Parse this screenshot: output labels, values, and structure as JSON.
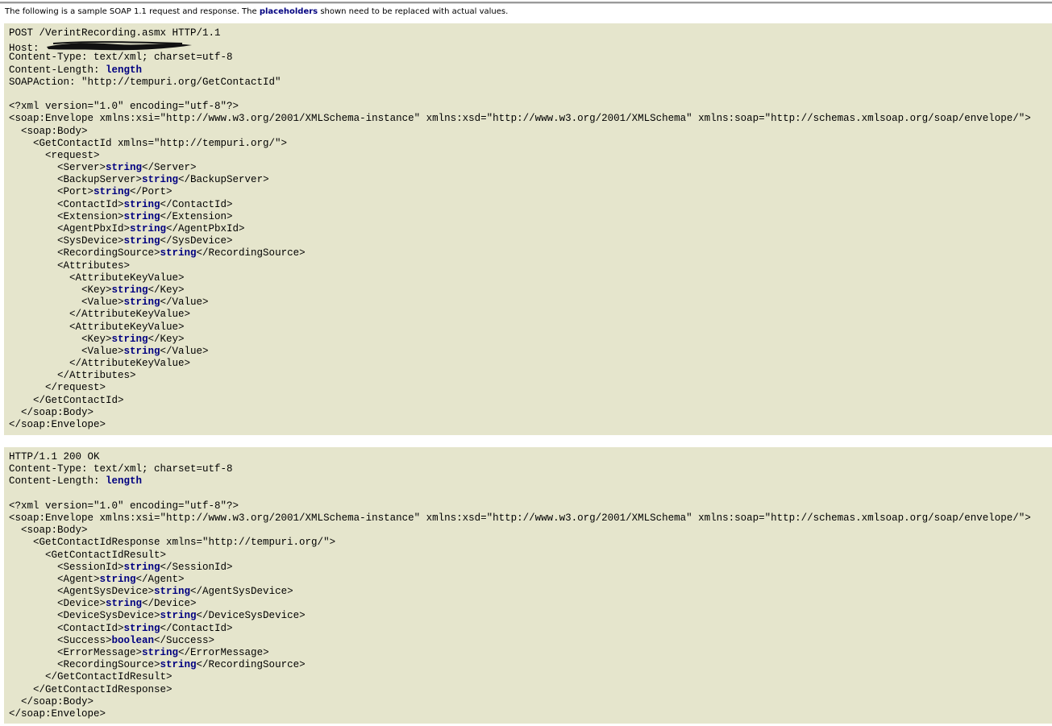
{
  "intro": {
    "pre": "The following is a sample SOAP 1.1 request and response. The ",
    "highlight": "placeholders",
    "post": " shown need to be replaced with actual values."
  },
  "colors": {
    "block_bg": "#e5e5cc",
    "placeholder": "#000080"
  },
  "request": [
    {
      "pre": "POST /VerintRecording.asmx HTTP/1.1"
    },
    {
      "pre": "Host: ",
      "redacted": true
    },
    {
      "pre": "Content-Type: text/xml; charset=utf-8"
    },
    {
      "pre": "Content-Length: ",
      "ph": "length"
    },
    {
      "pre": "SOAPAction: \"http://tempuri.org/GetContactId\""
    },
    {
      "pre": ""
    },
    {
      "pre": "<?xml version=\"1.0\" encoding=\"utf-8\"?>"
    },
    {
      "pre": "<soap:Envelope xmlns:xsi=\"http://www.w3.org/2001/XMLSchema-instance\" xmlns:xsd=\"http://www.w3.org/2001/XMLSchema\" xmlns:soap=\"http://schemas.xmlsoap.org/soap/envelope/\">"
    },
    {
      "pre": "  <soap:Body>"
    },
    {
      "pre": "    <GetContactId xmlns=\"http://tempuri.org/\">"
    },
    {
      "pre": "      <request>"
    },
    {
      "pre": "        <Server>",
      "ph": "string",
      "post": "</Server>"
    },
    {
      "pre": "        <BackupServer>",
      "ph": "string",
      "post": "</BackupServer>"
    },
    {
      "pre": "        <Port>",
      "ph": "string",
      "post": "</Port>"
    },
    {
      "pre": "        <ContactId>",
      "ph": "string",
      "post": "</ContactId>"
    },
    {
      "pre": "        <Extension>",
      "ph": "string",
      "post": "</Extension>"
    },
    {
      "pre": "        <AgentPbxId>",
      "ph": "string",
      "post": "</AgentPbxId>"
    },
    {
      "pre": "        <SysDevice>",
      "ph": "string",
      "post": "</SysDevice>"
    },
    {
      "pre": "        <RecordingSource>",
      "ph": "string",
      "post": "</RecordingSource>"
    },
    {
      "pre": "        <Attributes>"
    },
    {
      "pre": "          <AttributeKeyValue>"
    },
    {
      "pre": "            <Key>",
      "ph": "string",
      "post": "</Key>"
    },
    {
      "pre": "            <Value>",
      "ph": "string",
      "post": "</Value>"
    },
    {
      "pre": "          </AttributeKeyValue>"
    },
    {
      "pre": "          <AttributeKeyValue>"
    },
    {
      "pre": "            <Key>",
      "ph": "string",
      "post": "</Key>"
    },
    {
      "pre": "            <Value>",
      "ph": "string",
      "post": "</Value>"
    },
    {
      "pre": "          </AttributeKeyValue>"
    },
    {
      "pre": "        </Attributes>"
    },
    {
      "pre": "      </request>"
    },
    {
      "pre": "    </GetContactId>"
    },
    {
      "pre": "  </soap:Body>"
    },
    {
      "pre": "</soap:Envelope>"
    }
  ],
  "response": [
    {
      "pre": "HTTP/1.1 200 OK"
    },
    {
      "pre": "Content-Type: text/xml; charset=utf-8"
    },
    {
      "pre": "Content-Length: ",
      "ph": "length"
    },
    {
      "pre": ""
    },
    {
      "pre": "<?xml version=\"1.0\" encoding=\"utf-8\"?>"
    },
    {
      "pre": "<soap:Envelope xmlns:xsi=\"http://www.w3.org/2001/XMLSchema-instance\" xmlns:xsd=\"http://www.w3.org/2001/XMLSchema\" xmlns:soap=\"http://schemas.xmlsoap.org/soap/envelope/\">"
    },
    {
      "pre": "  <soap:Body>"
    },
    {
      "pre": "    <GetContactIdResponse xmlns=\"http://tempuri.org/\">"
    },
    {
      "pre": "      <GetContactIdResult>"
    },
    {
      "pre": "        <SessionId>",
      "ph": "string",
      "post": "</SessionId>"
    },
    {
      "pre": "        <Agent>",
      "ph": "string",
      "post": "</Agent>"
    },
    {
      "pre": "        <AgentSysDevice>",
      "ph": "string",
      "post": "</AgentSysDevice>"
    },
    {
      "pre": "        <Device>",
      "ph": "string",
      "post": "</Device>"
    },
    {
      "pre": "        <DeviceSysDevice>",
      "ph": "string",
      "post": "</DeviceSysDevice>"
    },
    {
      "pre": "        <ContactId>",
      "ph": "string",
      "post": "</ContactId>"
    },
    {
      "pre": "        <Success>",
      "ph": "boolean",
      "post": "</Success>"
    },
    {
      "pre": "        <ErrorMessage>",
      "ph": "string",
      "post": "</ErrorMessage>"
    },
    {
      "pre": "        <RecordingSource>",
      "ph": "string",
      "post": "</RecordingSource>"
    },
    {
      "pre": "      </GetContactIdResult>"
    },
    {
      "pre": "    </GetContactIdResponse>"
    },
    {
      "pre": "  </soap:Body>"
    },
    {
      "pre": "</soap:Envelope>"
    }
  ]
}
